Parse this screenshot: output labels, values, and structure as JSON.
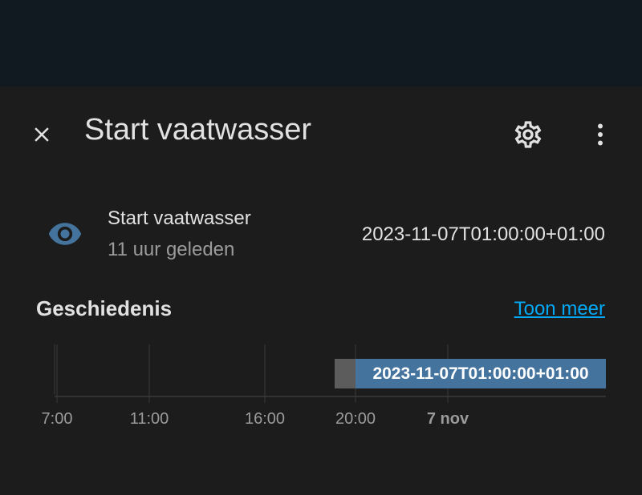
{
  "dialog": {
    "title": "Start vaatwasser",
    "close_icon": "close-icon",
    "settings_icon": "gear-icon",
    "more_icon": "more-vertical-icon"
  },
  "entity": {
    "icon": "eye-icon",
    "icon_color": "#44739e",
    "name": "Start vaatwasser",
    "secondary": "11 uur geleden",
    "state": "2023-11-07T01:00:00+01:00"
  },
  "history": {
    "title": "Geschiedenis",
    "show_more": "Toon meer",
    "timeline": {
      "bar_label": "2023-11-07T01:00:00+01:00",
      "bar_color": "#44739e",
      "unknown_color": "#5c5c5c",
      "ticks": [
        "7:00",
        "11:00",
        "16:00",
        "20:00",
        "7 nov"
      ]
    }
  },
  "colors": {
    "background": "#1c1c1c",
    "top_band": "#111a20",
    "link": "#03a9f4"
  }
}
